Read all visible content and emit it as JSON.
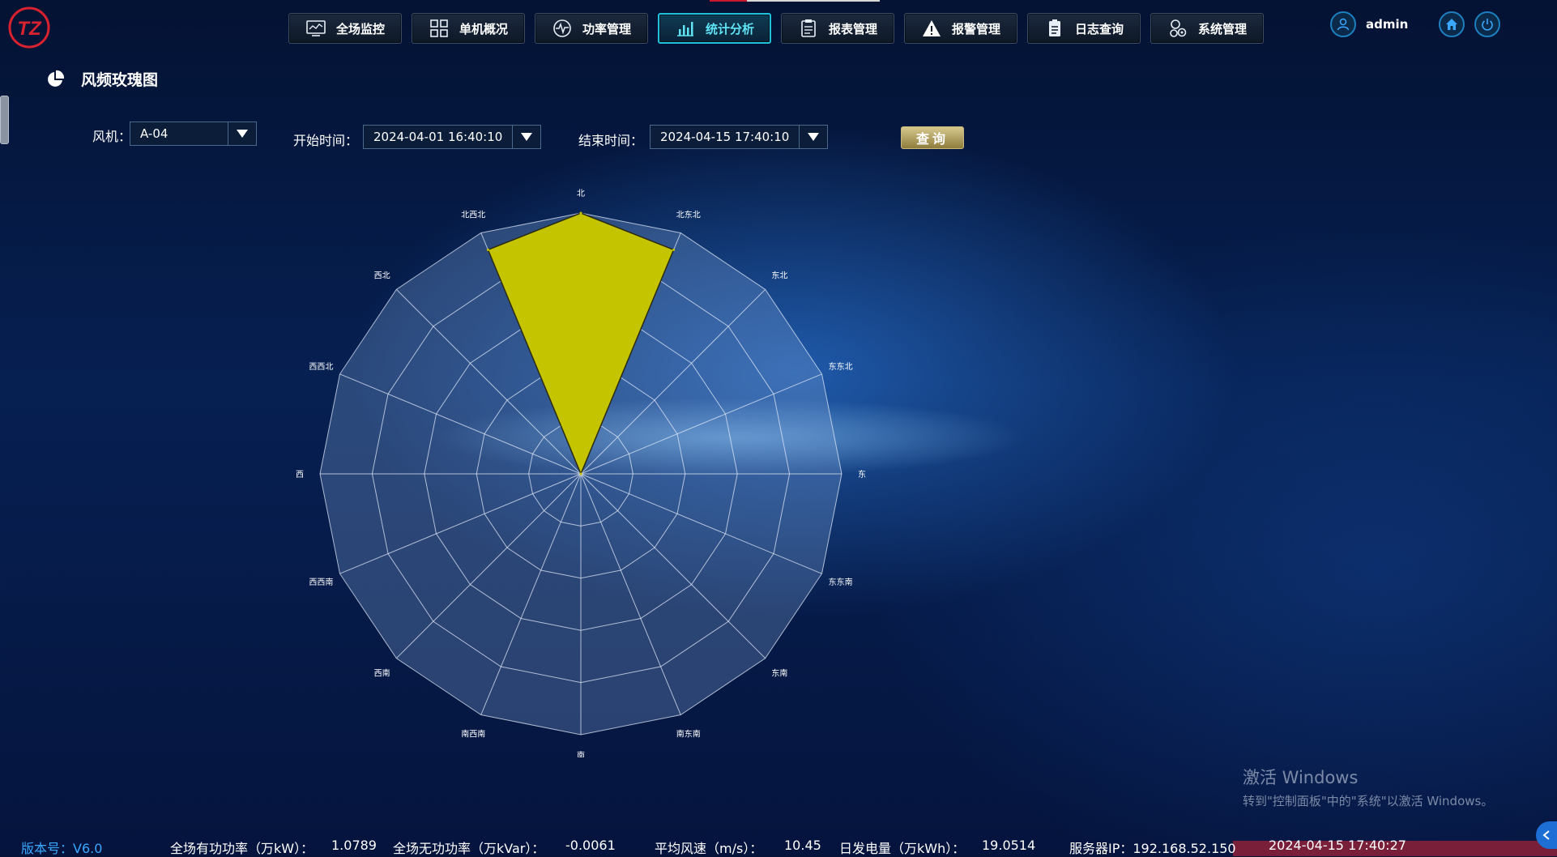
{
  "app": {
    "logo_text": "TZ"
  },
  "nav": [
    {
      "label": "全场监控",
      "icon": "monitor-icon",
      "active": false
    },
    {
      "label": "单机概况",
      "icon": "grid-icon",
      "active": false
    },
    {
      "label": "功率管理",
      "icon": "pulse-icon",
      "active": false
    },
    {
      "label": "统计分析",
      "icon": "bar-chart-icon",
      "active": true
    },
    {
      "label": "报表管理",
      "icon": "clipboard-icon",
      "active": false
    },
    {
      "label": "报警管理",
      "icon": "warning-icon",
      "active": false
    },
    {
      "label": "日志查询",
      "icon": "log-icon",
      "active": false
    },
    {
      "label": "系统管理",
      "icon": "settings-icon",
      "active": false
    }
  ],
  "user": {
    "name": "admin"
  },
  "page": {
    "title": "风频玫瑰图"
  },
  "filters": {
    "turbine_label": "风机：",
    "turbine_value": "A-04",
    "start_label": "开始时间：",
    "start_value": "2024-04-01 16:40:10",
    "end_label": "结束时间：",
    "end_value": "2024-04-15 17:40:10",
    "query_label": "查询"
  },
  "chart_data": {
    "type": "radar",
    "directions": [
      "北",
      "北东北",
      "东北",
      "东东北",
      "东",
      "东东南",
      "东南",
      "南东南",
      "南",
      "南西南",
      "西南",
      "西西南",
      "西",
      "西西北",
      "西北",
      "北西北"
    ],
    "values": [
      1.0,
      0.93,
      0.0,
      0.0,
      0.0,
      0.0,
      0.0,
      0.0,
      0.0,
      0.0,
      0.0,
      0.0,
      0.0,
      0.0,
      0.0,
      0.93
    ],
    "rings": 5,
    "fill_color": "#c4c400"
  },
  "status": {
    "version": "版本号：V6.0",
    "active_power_label": "全场有功功率（万kW）：",
    "active_power_value": "1.0789",
    "reactive_power_label": "全场无功功率（万kVar）：",
    "reactive_power_value": "-0.0061",
    "wind_label": "平均风速（m/s）：",
    "wind_value": "10.45",
    "energy_label": "日发电量（万kWh）：",
    "energy_value": "19.0514",
    "server_ip": "服务器IP：192.168.52.150",
    "datetime": "2024-04-15 17:40:27"
  },
  "watermark": {
    "line1": "激活 Windows",
    "line2": "转到\"控制面板\"中的\"系统\"以激活 Windows。"
  }
}
